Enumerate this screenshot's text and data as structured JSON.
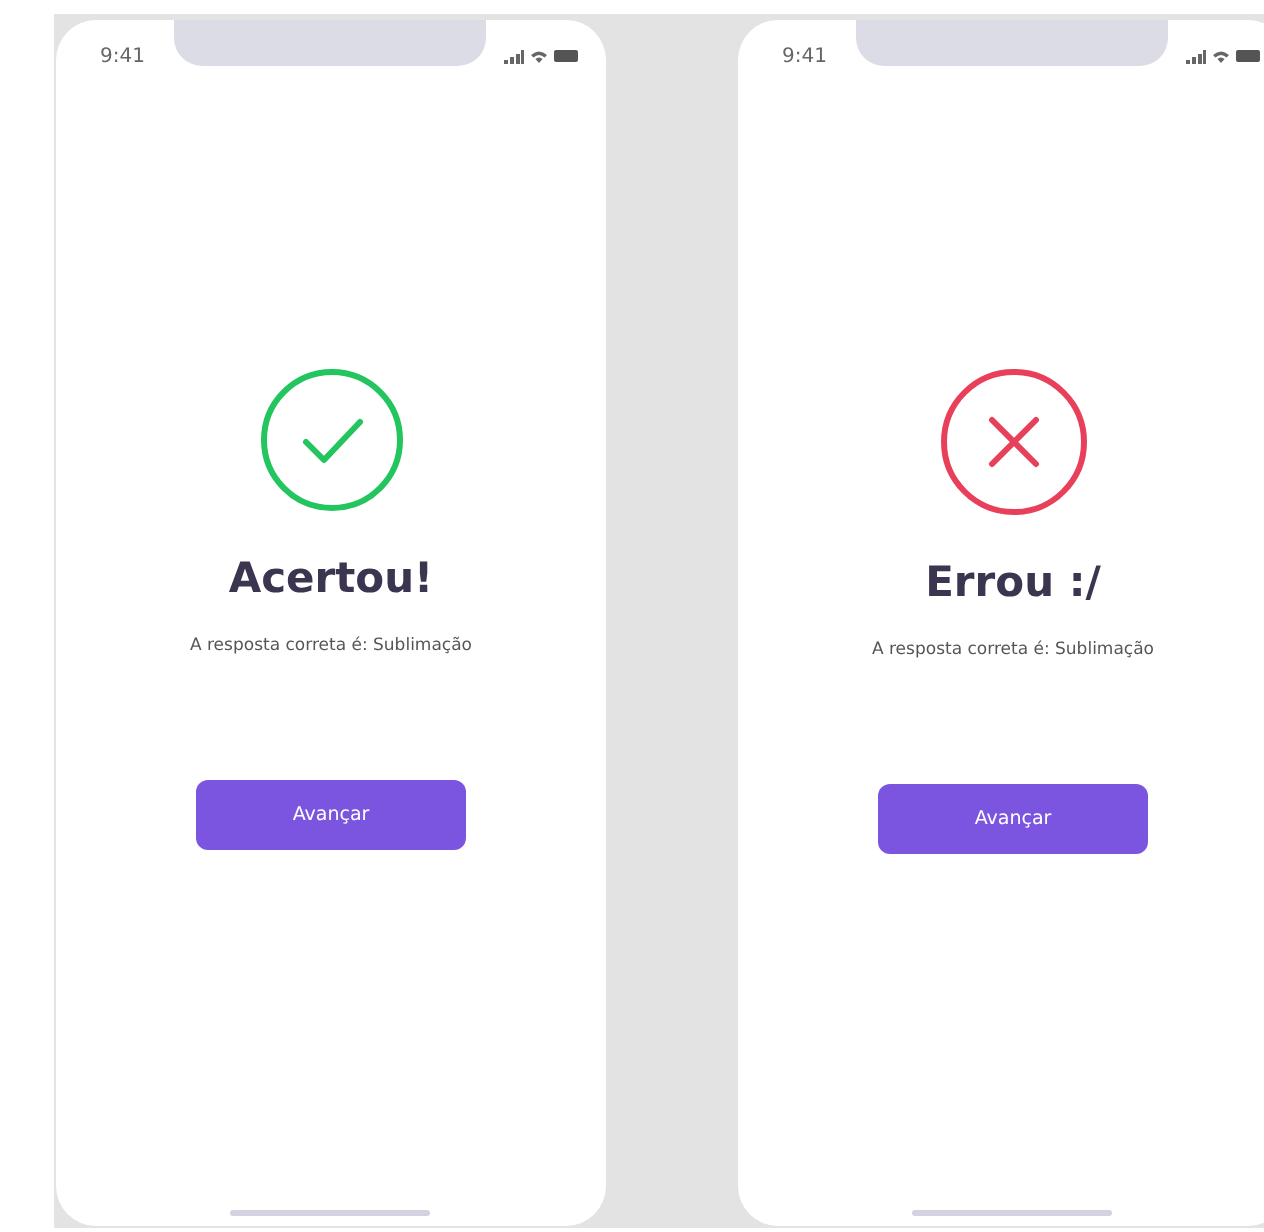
{
  "screens": [
    {
      "kind": "success",
      "time": "9:41",
      "title": "Acertou!",
      "message": "A resposta correta é: Sublimação",
      "button": "Avançar"
    },
    {
      "kind": "error",
      "time": "9:41",
      "title": "Errou :/",
      "message": "A resposta correta é: Sublimação",
      "button": "Avançar"
    }
  ]
}
